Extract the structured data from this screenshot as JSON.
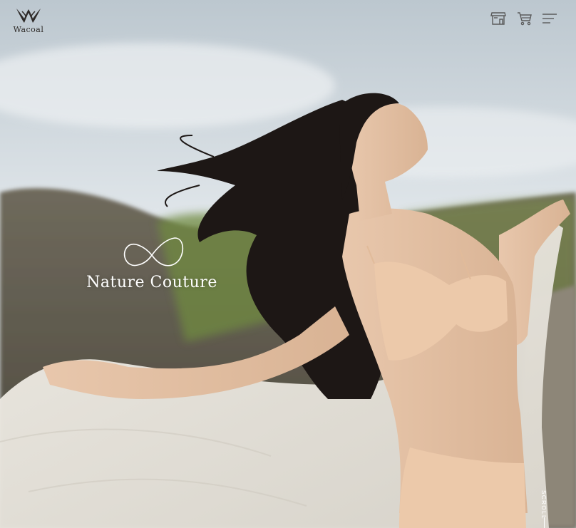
{
  "brand": {
    "name": "Wacoal",
    "logo_icon": "wacoal-w-logo-icon"
  },
  "header": {
    "icons": [
      "store-icon",
      "cart-icon",
      "menu-icon"
    ]
  },
  "hero": {
    "campaign_title": "Nature Couture",
    "campaign_icon": "infinity-icon",
    "scroll_label": "SCROLL"
  },
  "colors": {
    "logo_text": "#2e2a28",
    "header_icons": "#5a5a5a",
    "overlay_text": "#ffffff",
    "sky": "#d5dde3",
    "skin": "#e2bfa2",
    "garment": "#edccae"
  }
}
